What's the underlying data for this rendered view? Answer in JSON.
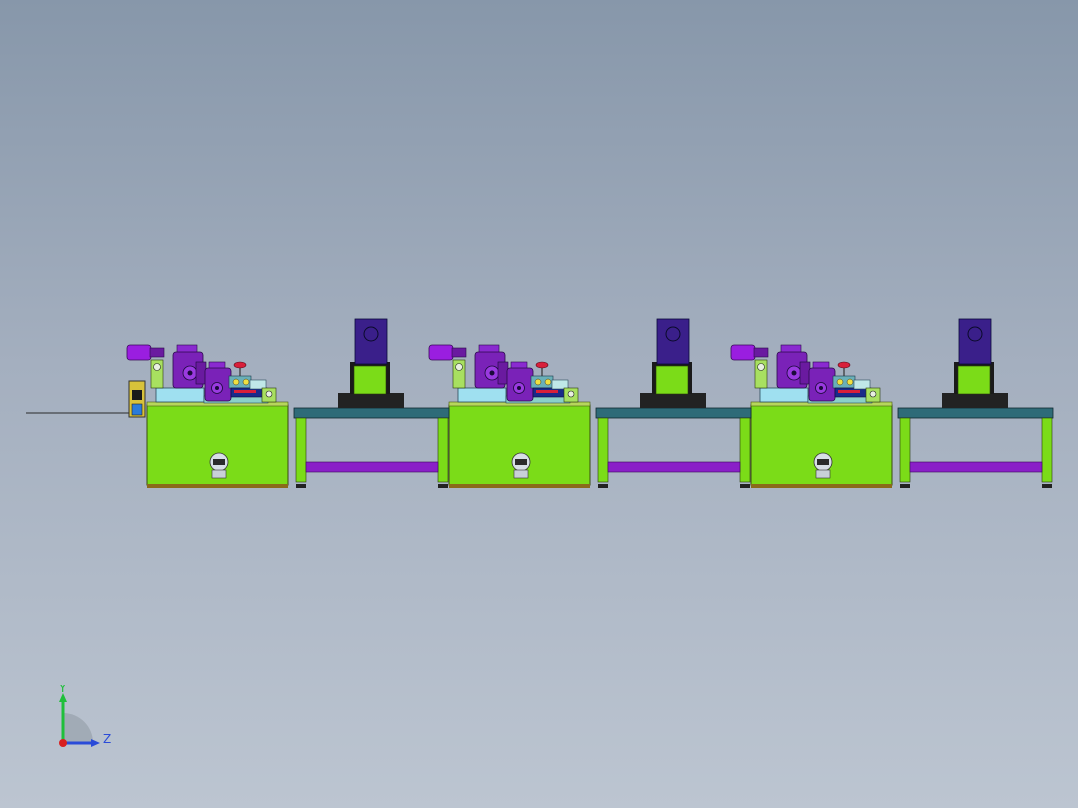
{
  "viewport": {
    "background_top": "#8797aa",
    "background_bottom": "#bcc5d1"
  },
  "model": {
    "station_count": 3,
    "conveyor_count": 3,
    "colors": {
      "machine_body": "#7bdc18",
      "machine_base": "#8a6a1a",
      "conveyor_top": "#2e6b78",
      "conveyor_leg": "#7bdc18",
      "crossbar": "#8a1fc8",
      "motor": "#9a1ee0",
      "gearbox": "#7a22b8",
      "cabinet_top": "#3a1f8a",
      "cabinet_base": "#222222"
    }
  },
  "triad": {
    "y_label": "Y",
    "z_label": "Z",
    "y_color": "#1fbf3a",
    "z_color": "#2a4bd8",
    "x_color": "#d81f1f"
  }
}
